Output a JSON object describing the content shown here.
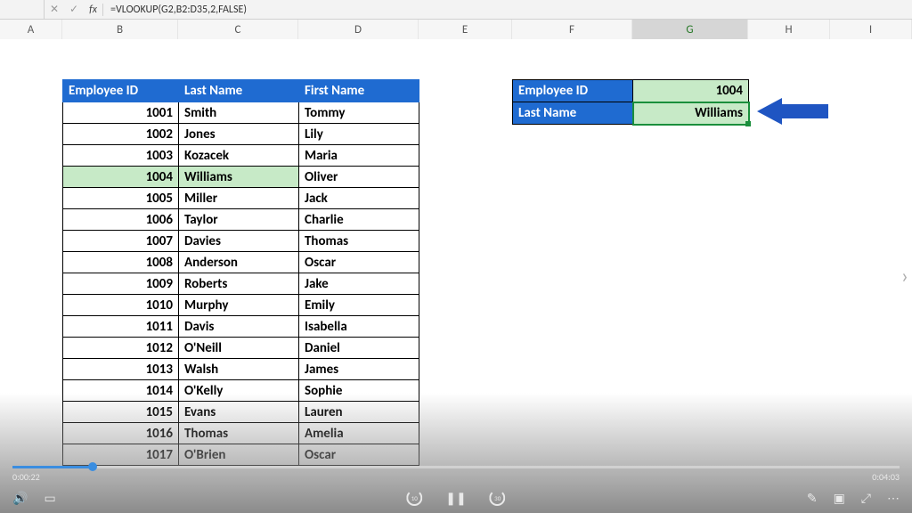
{
  "formula_bar": {
    "cancel": "✕",
    "accept": "✓",
    "fx": "fx",
    "formula": "=VLOOKUP(G2,B2:D35,2,FALSE)"
  },
  "columns": [
    "A",
    "B",
    "C",
    "D",
    "E",
    "F",
    "G",
    "H",
    "I"
  ],
  "selected_column": "G",
  "headers": {
    "id": "Employee ID",
    "ln": "Last Name",
    "fn": "First Name"
  },
  "rows": [
    {
      "id": "1001",
      "ln": "Smith",
      "fn": "Tommy"
    },
    {
      "id": "1002",
      "ln": "Jones",
      "fn": "Lily"
    },
    {
      "id": "1003",
      "ln": "Kozacek",
      "fn": "Maria"
    },
    {
      "id": "1004",
      "ln": "Williams",
      "fn": "Oliver",
      "highlight": true
    },
    {
      "id": "1005",
      "ln": "Miller",
      "fn": "Jack"
    },
    {
      "id": "1006",
      "ln": "Taylor",
      "fn": "Charlie"
    },
    {
      "id": "1007",
      "ln": "Davies",
      "fn": "Thomas"
    },
    {
      "id": "1008",
      "ln": "Anderson",
      "fn": "Oscar"
    },
    {
      "id": "1009",
      "ln": "Roberts",
      "fn": "Jake"
    },
    {
      "id": "1010",
      "ln": "Murphy",
      "fn": "Emily"
    },
    {
      "id": "1011",
      "ln": "Davis",
      "fn": "Isabella"
    },
    {
      "id": "1012",
      "ln": "O'Neill",
      "fn": "Daniel"
    },
    {
      "id": "1013",
      "ln": "Walsh",
      "fn": "James"
    },
    {
      "id": "1014",
      "ln": "O'Kelly",
      "fn": "Sophie"
    },
    {
      "id": "1015",
      "ln": "Evans",
      "fn": "Lauren"
    },
    {
      "id": "1016",
      "ln": "Thomas",
      "fn": "Amelia"
    },
    {
      "id": "1017",
      "ln": "O'Brien",
      "fn": "Oscar"
    }
  ],
  "lookup": {
    "id_label": "Employee ID",
    "id_value": "1004",
    "ln_label": "Last Name",
    "ln_value": "Williams"
  },
  "video": {
    "elapsed": "0:00:22",
    "total": "0:04:03",
    "skip_seconds": "10",
    "skip_seconds_fwd": "30"
  }
}
